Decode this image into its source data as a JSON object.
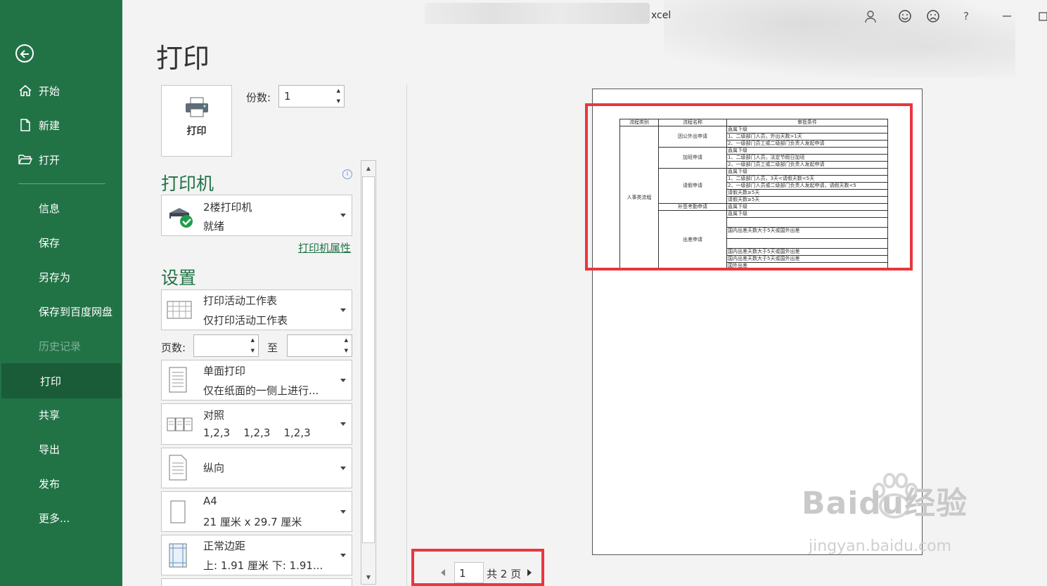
{
  "window": {
    "title_fragment": "xcel"
  },
  "sidebar": {
    "top_items": [
      {
        "label": "开始",
        "icon": "home-icon"
      },
      {
        "label": "新建",
        "icon": "new-file-icon"
      },
      {
        "label": "打开",
        "icon": "folder-open-icon"
      }
    ],
    "items": [
      {
        "label": "信息"
      },
      {
        "label": "保存"
      },
      {
        "label": "另存为"
      },
      {
        "label": "保存到百度网盘"
      },
      {
        "label": "历史记录",
        "disabled": true
      },
      {
        "label": "打印",
        "active": true
      },
      {
        "label": "共享"
      },
      {
        "label": "导出"
      },
      {
        "label": "发布"
      },
      {
        "label": "更多..."
      }
    ]
  },
  "main": {
    "title": "打印",
    "print_button_label": "打印",
    "copies_label": "份数:",
    "copies_value": "1",
    "printer_section": "打印机",
    "printer": {
      "name": "2楼打印机",
      "status": "就绪"
    },
    "printer_properties": "打印机属性",
    "settings_section": "设置",
    "settings": {
      "scope": {
        "line1": "打印活动工作表",
        "line2": "仅打印活动工作表"
      },
      "pages_label": "页数:",
      "pages_to": "至",
      "sides": {
        "line1": "单面打印",
        "line2": "仅在纸面的一侧上进行..."
      },
      "collate": {
        "line1": "对照",
        "line2": "1,2,3    1,2,3    1,2,3"
      },
      "orientation": {
        "line1": "纵向"
      },
      "paper": {
        "line1": "A4",
        "line2": "21 厘米 x 29.7 厘米"
      },
      "margins": {
        "line1": "正常边距",
        "line2": "上: 1.91 厘米 下: 1.91..."
      }
    }
  },
  "preview": {
    "headers": [
      "流程类别",
      "流程名称",
      "审批条件"
    ],
    "category": "人事类流程",
    "groups": [
      {
        "name": "因公外出申请",
        "rows": [
          "直属下级",
          "1、二级部门人员，外出天数>1天",
          "2、一级部门员工或二级部门负责人发起申请"
        ]
      },
      {
        "name": "加班申请",
        "rows": [
          "直属下级",
          "1、二级部门人员，法定节假日加班",
          "2、一级部门员工或二级部门负责人发起申请"
        ]
      },
      {
        "name": "请假申请",
        "rows": [
          "直属下级",
          "1、二级部门人员，3天<请假天数<5天",
          "2、一级部门人员或二级部门负责人发起申请，请假天数<5",
          "请假天数≥5天",
          "请假天数≥5天"
        ]
      },
      {
        "name": "补签考勤申请",
        "rows": [
          "直属下级"
        ]
      },
      {
        "name": "出差申请",
        "rows": [
          "直属下级",
          "国内出差天数大于5天或国外出差",
          "国内出差天数大于5天或国外出差",
          "国内出差天数大于5天或国外出差",
          "国外出差"
        ]
      }
    ],
    "pager": {
      "current": "1",
      "total_text": "共 2 页"
    }
  },
  "watermark": {
    "brand": "Baidu经验",
    "url": "jingyan.baidu.com"
  },
  "colors": {
    "sidebar": "#217346",
    "sidebar_active": "#195c37",
    "accent": "#217346",
    "highlight": "#e8373d"
  }
}
